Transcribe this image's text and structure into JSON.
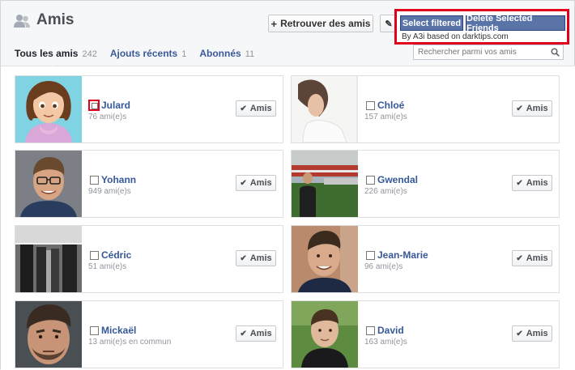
{
  "header": {
    "title": "Amis",
    "find_friends_label": "Retrouver des amis",
    "find_friends_icon": "plus-icon",
    "edit_icon": "pencil-icon"
  },
  "extension": {
    "select_filtered_label": "Select filtered",
    "delete_selected_label": "Delete Selected Friends",
    "credit": "By A3i based on darktips.com",
    "highlight_color": "#e0001b",
    "button_color": "#5b74a8"
  },
  "tabs": [
    {
      "label": "Tous les amis",
      "count": "242",
      "active": true
    },
    {
      "label": "Ajouts récents",
      "count": "1",
      "active": false
    },
    {
      "label": "Abonnés",
      "count": "11",
      "active": false
    }
  ],
  "search": {
    "placeholder": "Rechercher parmi vos amis",
    "icon": "search-icon"
  },
  "friend_button_label": "Amis",
  "friends": [
    {
      "name": "Julard",
      "mutual": "76 ami(e)s"
    },
    {
      "name": "Chloé",
      "mutual": "157 ami(e)s"
    },
    {
      "name": "Yohann",
      "mutual": "949 ami(e)s"
    },
    {
      "name": "Gwendal",
      "mutual": "226 ami(e)s"
    },
    {
      "name": "Cédric",
      "mutual": "51 ami(e)s"
    },
    {
      "name": "Jean-Marie",
      "mutual": "96 ami(e)s"
    },
    {
      "name": "Mickaël",
      "mutual": "13 ami(e)s en commun"
    },
    {
      "name": "David",
      "mutual": "163 ami(e)s"
    }
  ],
  "colors": {
    "link": "#365899",
    "tab_link": "#3b5998"
  }
}
